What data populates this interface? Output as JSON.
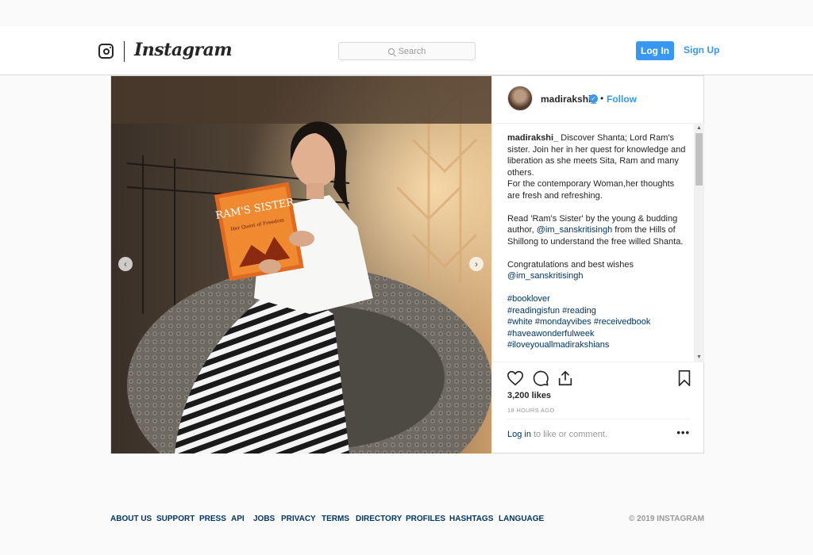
{
  "nav": {
    "logo_text": "Instagram",
    "search_placeholder": "Search",
    "login_label": "Log In",
    "signup_label": "Sign Up"
  },
  "post": {
    "username": "madirakshi_",
    "follow_label": "Follow",
    "bullet": "•",
    "caption": {
      "username": "madirakshi_",
      "lines": [
        "Discover Shanta; Lord Ram's sister. Join her in her quest for knowledge and liberation as she meets Sita, Ram and many others.",
        "For the contemporary Woman,her thoughts are fresh and refreshing."
      ],
      "para2_start": "Read 'Ram's Sister' by the young & budding author,",
      "para2_mention": "@im_sanskritisingh",
      "para2_end": "from the Hills of Shillong to understand the free willed Shanta.",
      "para3": "Congratulations and best wishes",
      "para3_mention": "@im_sanskritisingh",
      "hashtags": [
        "#booklover",
        "#readingisfun #reading",
        "#white #mondayvibes #receivedbook",
        "#haveawonderfulweek",
        "#iloveyouallmadirakshians"
      ]
    },
    "likes": "3,200 likes",
    "time_ago": "18 HOURS AGO",
    "login_link": "Log in",
    "login_rest": "to like or comment.",
    "more": "•••",
    "photo_book_title": "RAM'S SISTER",
    "photo_book_subtitle": "Her Quest of Freedom",
    "prev_arrow": "‹",
    "next_arrow": "›"
  },
  "footer": {
    "links": [
      "ABOUT US",
      "SUPPORT",
      "PRESS",
      "API",
      "JOBS",
      "PRIVACY",
      "TERMS",
      "DIRECTORY",
      "PROFILES",
      "HASHTAGS",
      "LANGUAGE"
    ],
    "copyright": "© 2019 INSTAGRAM"
  },
  "colors": {
    "accent": "#3897f0",
    "link": "#003569",
    "border": "#dbdbdb"
  }
}
